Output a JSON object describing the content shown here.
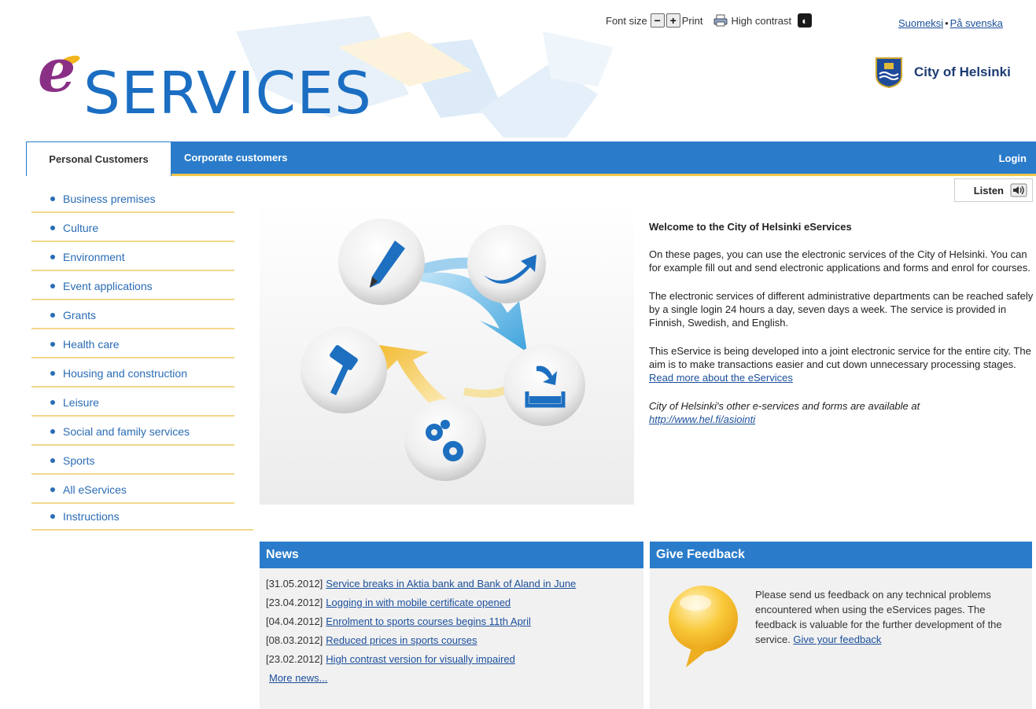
{
  "header": {
    "logo_letter": "e",
    "logo_word": "SERVICES",
    "city_name": "City of Helsinki",
    "toolbar": {
      "font_size_label": "Font size",
      "decrease_symbol": "−",
      "increase_symbol": "+",
      "print_label": "Print",
      "high_contrast_label": "High contrast",
      "high_contrast_symbol": "◐"
    },
    "languages": [
      "Suomeksi",
      "På svenska"
    ],
    "language_separator": "•"
  },
  "nav": {
    "tabs": [
      {
        "label": "Personal Customers",
        "active": true
      },
      {
        "label": "Corporate customers",
        "active": false
      }
    ],
    "login_label": "Login",
    "listen_label": "Listen"
  },
  "sidebar": {
    "items": [
      "Business premises",
      "Culture",
      "Environment",
      "Event applications",
      "Grants",
      "Health care",
      "Housing and construction",
      "Leisure",
      "Social and family services",
      "Sports",
      "All eServices"
    ],
    "instructions": "Instructions"
  },
  "welcome": {
    "title": "Welcome to the City of Helsinki eServices",
    "p1": "On these pages, you can use the electronic services of the City of Helsinki. You can for example fill out and send electronic applications and forms and enrol for courses.",
    "p2": "The electronic services of different administrative departments can be reached safely by a single login 24 hours a day, seven days a week. The service is provided in Finnish, Swedish, and English.",
    "p3": "This eService is being developed into a joint electronic service for the entire city. The aim is to make transactions easier and cut down unnecessary processing stages.",
    "read_more": "Read more about the eServices",
    "other_text": "City of Helsinki's other e-services and forms are available at",
    "other_link": "http://www.hel.fi/asiointi"
  },
  "news": {
    "title": "News",
    "items": [
      {
        "date": "[31.05.2012]",
        "text": "Service breaks in Aktia bank and Bank of Aland in June"
      },
      {
        "date": "[23.04.2012]",
        "text": "Logging in with mobile certificate opened"
      },
      {
        "date": "[04.04.2012]",
        "text": "Enrolment to sports courses begins 11th April"
      },
      {
        "date": "[08.03.2012]",
        "text": "Reduced prices in sports courses"
      },
      {
        "date": "[23.02.2012]",
        "text": "High contrast version for visually impaired"
      }
    ],
    "more": "More news..."
  },
  "feedback": {
    "title": "Give Feedback",
    "text": "Please send us feedback on any technical problems encountered when using the eServices pages. The feedback is valuable for the further development of the service.",
    "link": "Give your feedback"
  },
  "colors": {
    "accent": "#2a7cca",
    "gold": "#f2c649",
    "logo_purple": "#8a2f86",
    "link": "#1b4f9c"
  }
}
